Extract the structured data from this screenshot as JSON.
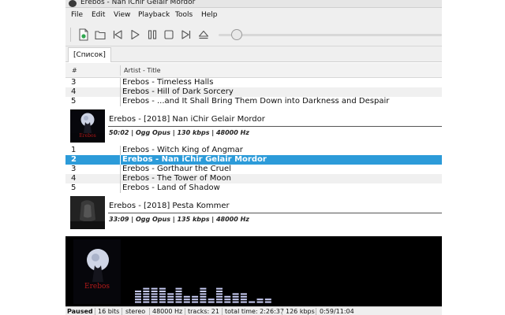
{
  "window": {
    "title": "Erebos - Nan iChir Gelair Mordor"
  },
  "menu": [
    "File",
    "Edit",
    "View",
    "Playback",
    "Tools",
    "Help"
  ],
  "toolbar": {
    "buttons": [
      "new-playlist-icon",
      "open-folder-icon",
      "previous-icon",
      "play-icon",
      "pause-icon",
      "stop-icon",
      "next-icon",
      "eject-icon"
    ],
    "seek_position": 0.08
  },
  "tabs": [
    "[Список]"
  ],
  "columns": {
    "number": "#",
    "artist_title": "Artist - Title"
  },
  "playlist": {
    "pre_rows": [
      {
        "num": "3",
        "text": "Erebos - Timeless Halls"
      },
      {
        "num": "4",
        "text": "Erebos - Hill of Dark Sorcery"
      },
      {
        "num": "5",
        "text": "Erebos - ...and It Shall Bring Them Down into Darkness and Despair"
      }
    ],
    "groups": [
      {
        "title": "Erebos - [2018] Nan iChir Gelair Mordor",
        "info": "50:02 | Ogg Opus | 130 kbps | 48000 Hz",
        "cover_label": "Erebos",
        "rows": [
          {
            "num": "1",
            "text": "Erebos - Witch King of Angmar"
          },
          {
            "num": "2",
            "text": "Erebos - Nan iChir Gelair Mordor",
            "selected": true
          },
          {
            "num": "3",
            "text": "Erebos - Gorthaur the Cruel"
          },
          {
            "num": "4",
            "text": "Erebos - The Tower of Moon"
          },
          {
            "num": "5",
            "text": "Erebos - Land of Shadow"
          }
        ]
      },
      {
        "title": "Erebos - [2018] Pesta Kommer",
        "info": "33:09 | Ogg Opus | 135 kbps | 48000 Hz"
      }
    ]
  },
  "visualizer": {
    "cover_label": "Erebos",
    "bar_color": "#c8ccf4",
    "levels": [
      0.38,
      0.42,
      0.42,
      0.42,
      0.28,
      0.42,
      0.2,
      0.22,
      0.42,
      0.12,
      0.42,
      0.2,
      0.25,
      0.25,
      0.06,
      0.12,
      0.12
    ]
  },
  "status": {
    "state": "Paused",
    "bits": "16 bits",
    "channels": "stereo",
    "samplerate": "48000 Hz",
    "tracks": "tracks: 21",
    "total_time": "total time: 2:26:37",
    "bitrate": "126 kbps",
    "position": "0:59/11:04"
  }
}
